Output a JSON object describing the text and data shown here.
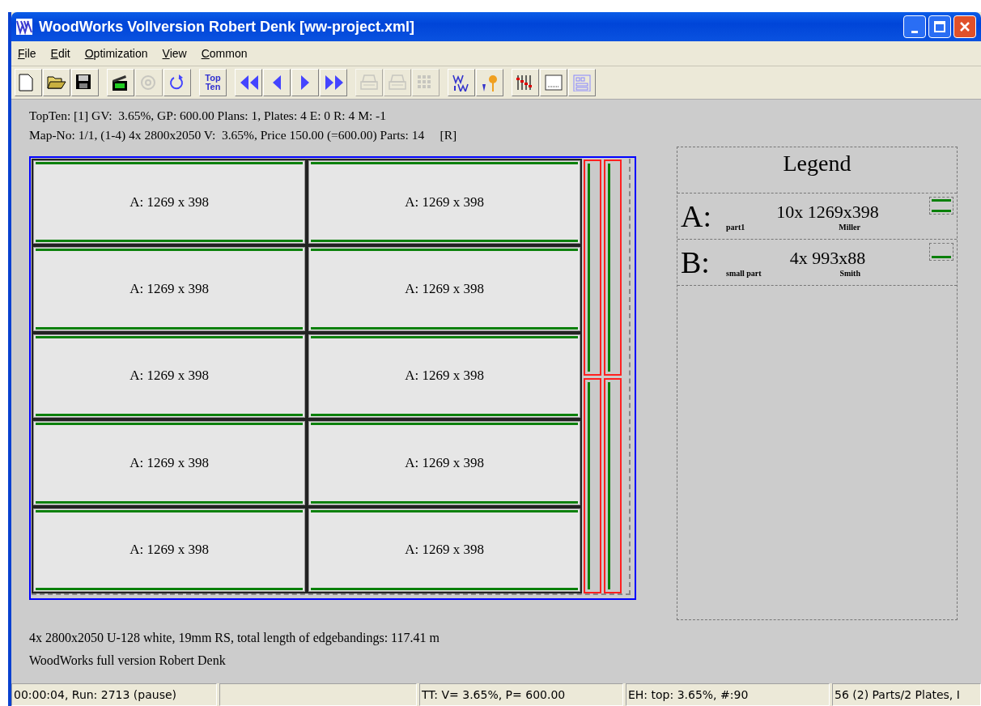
{
  "window": {
    "title": "WoodWorks Vollversion Robert Denk [ww-project.xml]"
  },
  "menu": [
    {
      "label": "File"
    },
    {
      "label": "Edit"
    },
    {
      "label": "Optimization"
    },
    {
      "label": "View"
    },
    {
      "label": "Common"
    }
  ],
  "toolbar": [
    [
      {
        "disabled": false
      },
      {
        "disabled": false
      },
      {
        "disabled": false
      }
    ],
    [
      {
        "disabled": false
      },
      {
        "disabled": true
      },
      {
        "disabled": false
      }
    ],
    [
      {
        "kind": "text",
        "lines": [
          "Top",
          "Ten"
        ],
        "disabled": false
      }
    ],
    [
      {
        "disabled": false
      },
      {
        "disabled": false
      },
      {
        "disabled": false
      },
      {
        "disabled": false
      }
    ],
    [
      {
        "disabled": true
      },
      {
        "disabled": true
      },
      {
        "disabled": true
      }
    ],
    [
      {
        "disabled": false
      },
      {
        "disabled": false
      }
    ],
    [
      {
        "disabled": false
      },
      {
        "disabled": false
      },
      {
        "disabled": false
      }
    ]
  ],
  "info": [
    "TopTen: [1] GV:  3.65%, GP: 600.00 Plans: 1, Plates: 4 E: 0 R: 4 M: -1",
    "Map-No: 1/1, (1-4) 4x 2800x2050 V:  3.65%, Price 150.00 (=600.00) Parts: 14     [R]"
  ],
  "plan": {
    "parts": [
      {
        "label": "A: 1269 x 398"
      },
      {
        "label": "A: 1269 x 398"
      },
      {
        "label": "A: 1269 x 398"
      },
      {
        "label": "A: 1269 x 398"
      },
      {
        "label": "A: 1269 x 398"
      },
      {
        "label": "A: 1269 x 398"
      },
      {
        "label": "A: 1269 x 398"
      },
      {
        "label": "A: 1269 x 398"
      },
      {
        "label": "A: 1269 x 398"
      },
      {
        "label": "A: 1269 x 398"
      }
    ]
  },
  "legend": {
    "title": "Legend",
    "entries": [
      {
        "letter": "A:",
        "size": "10x 1269x398",
        "name": "part1",
        "customer": "Miller",
        "edge_top": true,
        "edge_bottom": true
      },
      {
        "letter": "B:",
        "size": "4x 993x88",
        "name": "small part",
        "customer": "Smith",
        "edge_top": false,
        "edge_bottom": true
      }
    ]
  },
  "footer": [
    "4x 2800x2050 U-128 white, 19mm RS, total length of edgebandings: 117.41 m",
    "WoodWorks full version Robert Denk"
  ],
  "status_bar": [
    "00:00:04, Run: 2713 (pause)",
    "TT: V= 3.65%, P= 600.00",
    "EH: top: 3.65%,  #:90",
    "56 (2) Parts/2 Plates, I"
  ]
}
